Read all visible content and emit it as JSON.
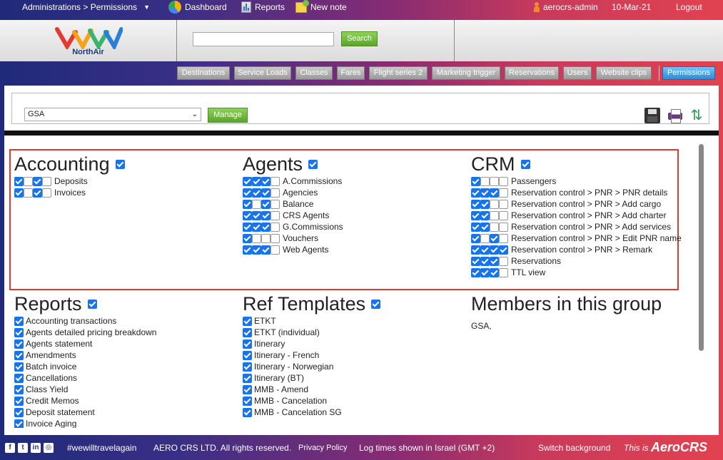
{
  "topbar": {
    "breadcrumb": "Administrations > Permissions",
    "dashboard": "Dashboard",
    "reports": "Reports",
    "new_note": "New note",
    "user": "aerocrs-admin",
    "date": "10-Mar-21",
    "logout": "Logout"
  },
  "header": {
    "logo_text": "NorthAir",
    "search_button": "Search",
    "search_value": ""
  },
  "nav": {
    "tabs": [
      "Destinations",
      "Service Loads",
      "Classes",
      "Fares",
      "Flight series 2",
      "Marketing trigger",
      "Reservations",
      "Users",
      "Website clips",
      "Permissions"
    ],
    "active": "Permissions"
  },
  "toolbar": {
    "group_select": "GSA",
    "manage_button": "Manage"
  },
  "sections": {
    "accounting": {
      "title": "Accounting",
      "checked": true,
      "rows": [
        {
          "label": "Deposits",
          "checks": [
            true,
            false,
            true,
            false
          ]
        },
        {
          "label": "Invoices",
          "checks": [
            true,
            false,
            true,
            false
          ]
        }
      ]
    },
    "agents": {
      "title": "Agents",
      "checked": true,
      "rows": [
        {
          "label": "A.Commissions",
          "checks": [
            true,
            true,
            true,
            false
          ]
        },
        {
          "label": "Agencies",
          "checks": [
            true,
            true,
            true,
            false
          ]
        },
        {
          "label": "Balance",
          "checks": [
            true,
            false,
            true,
            false
          ]
        },
        {
          "label": "CRS Agents",
          "checks": [
            true,
            true,
            true,
            false
          ]
        },
        {
          "label": "G.Commissions",
          "checks": [
            true,
            true,
            true,
            false
          ]
        },
        {
          "label": "Vouchers",
          "checks": [
            true,
            false,
            false,
            false
          ]
        },
        {
          "label": "Web Agents",
          "checks": [
            true,
            true,
            true,
            false
          ]
        }
      ]
    },
    "crm": {
      "title": "CRM",
      "checked": true,
      "rows": [
        {
          "label": "Passengers",
          "checks": [
            true,
            false,
            false,
            false
          ]
        },
        {
          "label": "Reservation control > PNR > PNR details",
          "checks": [
            true,
            true,
            true,
            false
          ]
        },
        {
          "label": "Reservation control > PNR > Add cargo",
          "checks": [
            true,
            true,
            false,
            false
          ]
        },
        {
          "label": "Reservation control > PNR > Add charter",
          "checks": [
            true,
            true,
            false,
            false
          ]
        },
        {
          "label": "Reservation control > PNR > Add services",
          "checks": [
            true,
            true,
            false,
            false
          ]
        },
        {
          "label": "Reservation control > PNR > Edit PNR name",
          "checks": [
            true,
            false,
            true,
            false
          ]
        },
        {
          "label": "Reservation control > PNR > Remark",
          "checks": [
            true,
            true,
            true,
            true
          ]
        },
        {
          "label": "Reservations",
          "checks": [
            true,
            true,
            true,
            false
          ]
        },
        {
          "label": "TTL view",
          "checks": [
            true,
            true,
            true,
            false
          ]
        }
      ]
    },
    "reports": {
      "title": "Reports",
      "checked": true,
      "rows": [
        "Accounting transactions",
        "Agents detailed pricing breakdown",
        "Agents statement",
        "Amendments",
        "Batch invoice",
        "Cancellations",
        "Class Yield",
        "Credit Memos",
        "Deposit statement",
        "Invoice Aging"
      ]
    },
    "ref_templates": {
      "title": "Ref Templates",
      "checked": true,
      "rows": [
        "ETKT",
        "ETKT (individual)",
        "Itinerary",
        "Itinerary - French",
        "Itinerary - Norwegian",
        "Itinerary (BT)",
        "MMB - Amend",
        "MMB - Cancelation",
        "MMB - Cancelation SG"
      ]
    },
    "members": {
      "title": "Members in this group",
      "list": "GSA,"
    }
  },
  "footer": {
    "hashtag": "#wewilltravelagain",
    "copyright": "AERO CRS LTD. All rights reserved.",
    "privacy": "Privacy Policy",
    "log_times": "Log times shown in Israel (GMT +2)",
    "switch_bg": "Switch background",
    "this_is": "This is",
    "brand": "AeroCRS"
  }
}
